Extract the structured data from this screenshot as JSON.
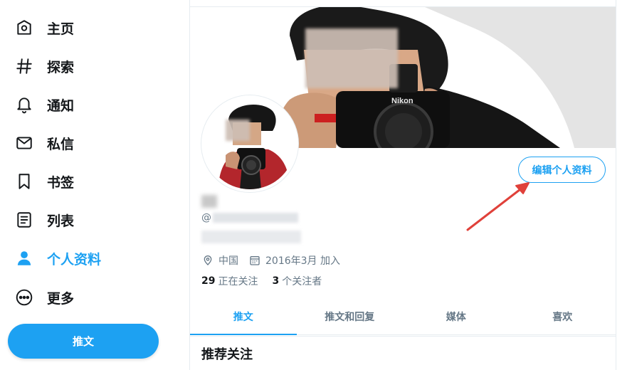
{
  "sidebar": {
    "items": [
      {
        "label": "主页",
        "icon": "home-icon"
      },
      {
        "label": "探索",
        "icon": "hashtag-icon"
      },
      {
        "label": "通知",
        "icon": "bell-icon"
      },
      {
        "label": "私信",
        "icon": "mail-icon"
      },
      {
        "label": "书签",
        "icon": "bookmark-icon"
      },
      {
        "label": "列表",
        "icon": "list-icon"
      },
      {
        "label": "个人资料",
        "icon": "person-icon",
        "active": true
      },
      {
        "label": "更多",
        "icon": "more-circle-icon"
      }
    ],
    "tweet_button": "推文"
  },
  "profile": {
    "edit_button": "编辑个人资料",
    "handle_prefix": "@",
    "location": "中国",
    "joined": "2016年3月 加入",
    "following_count": "29",
    "following_label": "正在关注",
    "followers_count": "3",
    "followers_label": "个关注者"
  },
  "tabs": [
    "推文",
    "推文和回复",
    "媒体",
    "喜欢"
  ],
  "recommend_title": "推荐关注",
  "colors": {
    "accent": "#1da1f2",
    "text": "#14171a",
    "muted": "#657786",
    "annotation_arrow": "#e0413a"
  }
}
